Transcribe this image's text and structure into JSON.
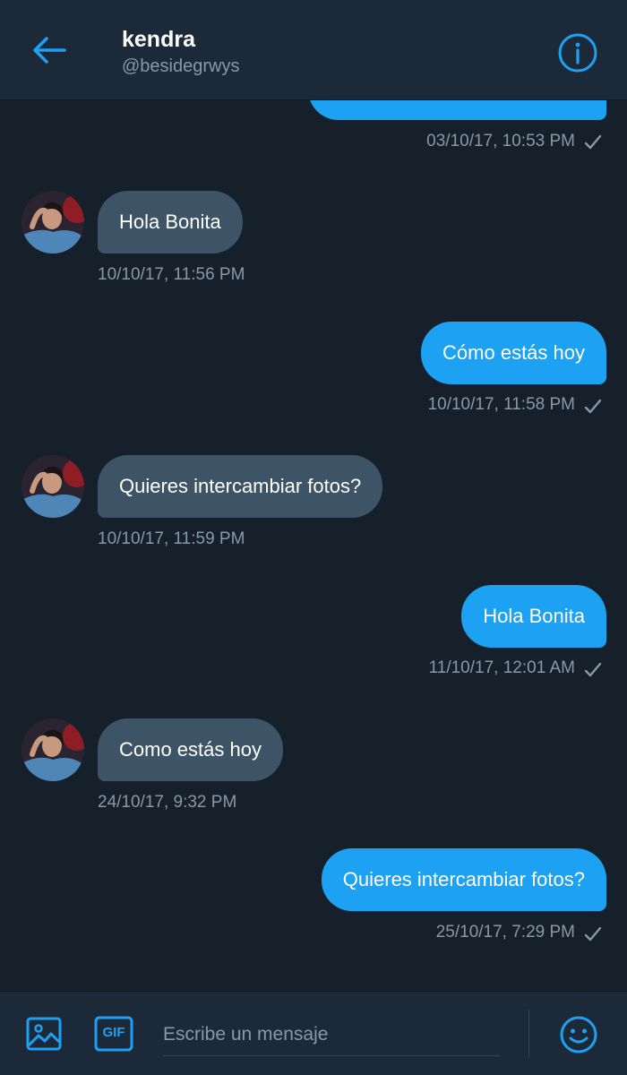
{
  "header": {
    "name": "kendra",
    "handle": "@besidegrwys"
  },
  "messages": [
    {
      "direction": "out",
      "text": "",
      "time": "03/10/17, 10:53 PM",
      "read": true
    },
    {
      "direction": "in",
      "text": "Hola Bonita",
      "time": "10/10/17, 11:56 PM"
    },
    {
      "direction": "out",
      "text": "Cómo estás hoy",
      "time": "10/10/17, 11:58 PM",
      "read": true
    },
    {
      "direction": "in",
      "text": "Quieres intercambiar fotos?",
      "time": "10/10/17, 11:59 PM"
    },
    {
      "direction": "out",
      "text": "Hola Bonita",
      "time": "11/10/17, 12:01 AM",
      "read": true
    },
    {
      "direction": "in",
      "text": "Como estás hoy",
      "time": "24/10/17, 9:32 PM"
    },
    {
      "direction": "out",
      "text": "Quieres intercambiar fotos?",
      "time": "25/10/17, 7:29 PM",
      "read": true
    }
  ],
  "composer": {
    "placeholder": "Escribe un mensaje",
    "gif_label": "GIF"
  },
  "colors": {
    "background": "#15202b",
    "header": "#1c2938",
    "accent": "#1da1f2",
    "incoming_bubble": "#3d5466",
    "muted_text": "#8899a6"
  },
  "icons": [
    "back-arrow-icon",
    "info-icon",
    "checkmark-icon",
    "image-icon",
    "gif-icon",
    "emoji-icon"
  ]
}
